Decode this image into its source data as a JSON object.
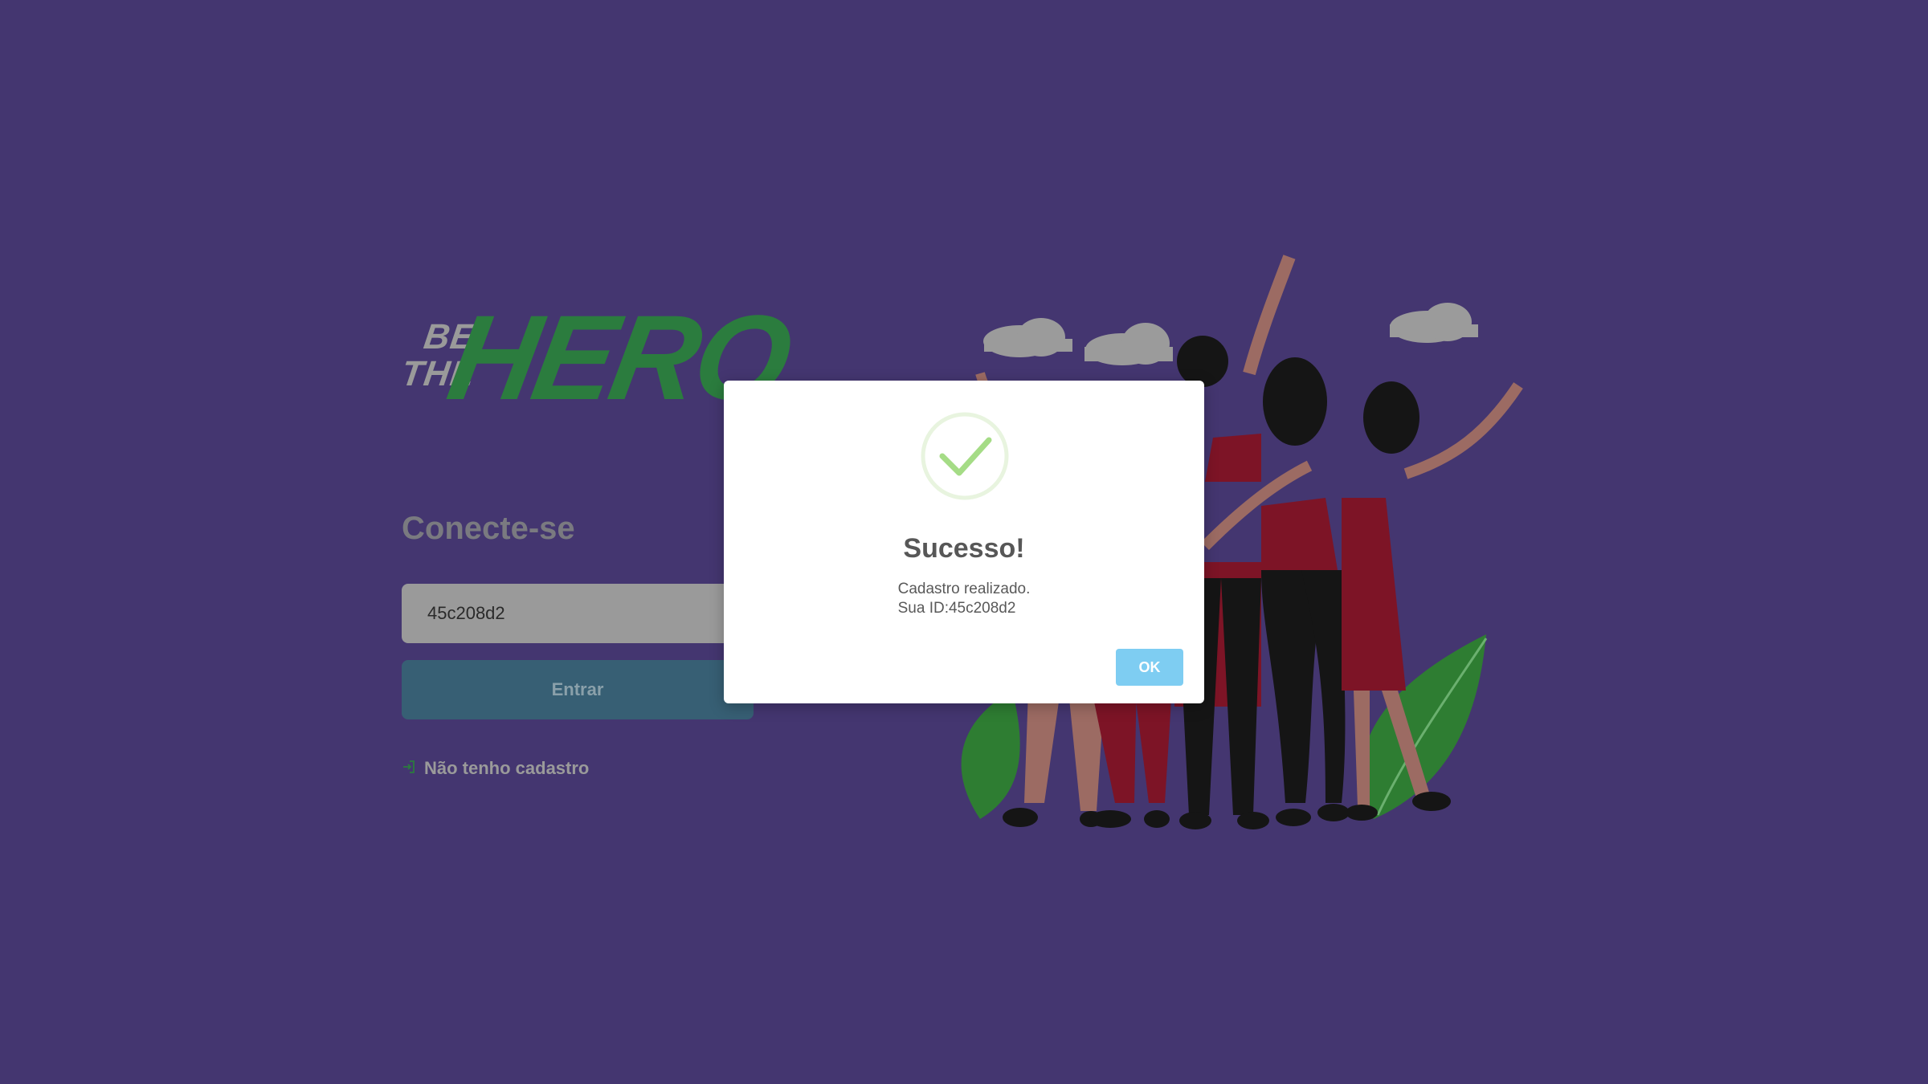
{
  "logo": {
    "line1": "BE",
    "line2": "THE",
    "line3": "HERO"
  },
  "login": {
    "title": "Conecte-se",
    "id_value": "45c208d2",
    "submit_label": "Entrar",
    "register_link": "Não tenho cadastro"
  },
  "modal": {
    "title": "Sucesso!",
    "message_line1": "Cadastro realizado.",
    "message_line2": "Sua ID:45c208d2",
    "ok_label": "OK"
  },
  "colors": {
    "background": "#443670",
    "brand_green": "#2b7c3e",
    "button": "#375f74",
    "ok_button": "#7ecdf2",
    "success": "#a5dc86"
  },
  "icons": {
    "register": "log-in-icon",
    "success": "check-circle-icon"
  }
}
